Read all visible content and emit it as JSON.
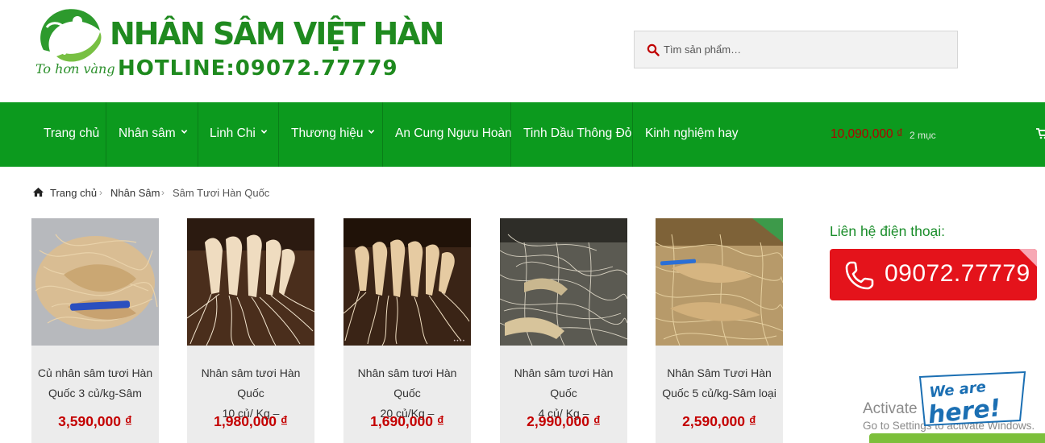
{
  "brand": {
    "name": "NHÂN SÂM VIỆT HÀN",
    "hotline": "HOTLINE:09072.77779",
    "slogan": "To hơn vàng",
    "color": "#1f8a1f"
  },
  "search": {
    "placeholder": "Tìm sản phẩm…",
    "value": ""
  },
  "nav": {
    "items": [
      {
        "label": "Trang chủ",
        "dropdown": false
      },
      {
        "label": "Nhân sâm",
        "dropdown": true
      },
      {
        "label": "Linh Chi",
        "dropdown": true
      },
      {
        "label": "Thương hiệu",
        "dropdown": true
      },
      {
        "label": "An Cung Ngưu Hoàn",
        "dropdown": false
      },
      {
        "label": "Tinh Dầu Thông Đỏ",
        "dropdown": false
      },
      {
        "label": "Kinh nghiệm hay",
        "dropdown": false
      }
    ],
    "cart": {
      "amount": "10,090,000 ₫",
      "count": "2 mục",
      "icon": "cart-icon"
    },
    "color": "#0c9a1e"
  },
  "breadcrumb": {
    "home": "Trang chủ",
    "parent": "Nhân Sâm",
    "current": "Sâm Tươi Hàn Quốc",
    "separator": "›"
  },
  "products": [
    {
      "name_line1": "Củ nhân sâm tươi Hàn",
      "name_line2": "Quốc 3 củ/kg-Sâm",
      "price": "3,590,000 ₫"
    },
    {
      "name_line1": "Nhân sâm tươi Hàn Quốc",
      "name_line2": "10 củ/ Kg –",
      "price": "1,980,000 ₫"
    },
    {
      "name_line1": "Nhân sâm tươi Hàn Quốc",
      "name_line2": "20 củ/Kg –",
      "price": "1,690,000 ₫"
    },
    {
      "name_line1": "Nhân sâm tươi Hàn Quốc",
      "name_line2": "4 củ/ Kg –",
      "price": "2,990,000 ₫"
    },
    {
      "name_line1": "Nhân Sâm Tươi Hàn",
      "name_line2": "Quốc 5 củ/kg-Sâm loại",
      "price": "2,590,000 ₫"
    }
  ],
  "sidebar": {
    "contact_label": "Liên hệ điện thoại:",
    "hotline_number": "09072.77779",
    "hotline_color": "#e4131b"
  },
  "overlay": {
    "activate_title": "Activate Windows",
    "activate_sub": "Go to Settings to activate Windows.",
    "chat_badge_text": "We are here!"
  },
  "colors": {
    "price": "#c40000",
    "accent_green": "#0c9a1e"
  }
}
